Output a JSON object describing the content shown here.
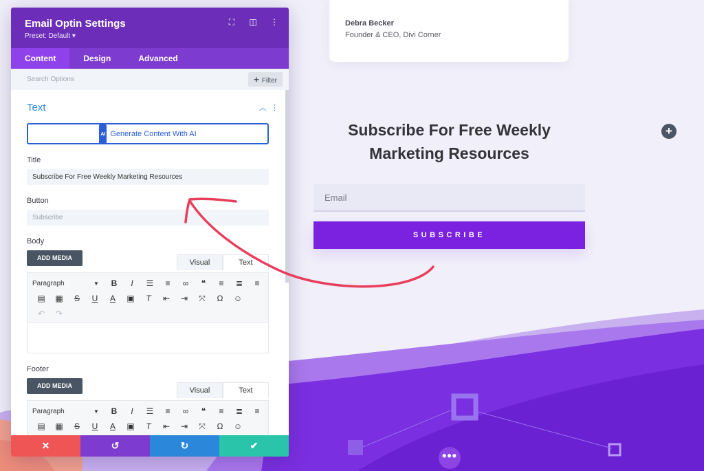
{
  "panel": {
    "title": "Email Optin Settings",
    "preset": "Preset: Default ▾",
    "header_icons": [
      "expand-icon",
      "split-view-icon",
      "more-vertical-icon"
    ],
    "tabs": [
      "Content",
      "Design",
      "Advanced"
    ],
    "active_tab": "Content",
    "search_placeholder": "Search Options",
    "filter_label": "Filter",
    "section_title": "Text",
    "ai_badge": "AI",
    "ai_button": "Generate Content With AI",
    "fields": {
      "title_label": "Title",
      "title_value": "Subscribe For Free Weekly Marketing Resources",
      "button_label": "Button",
      "button_placeholder": "Subscribe",
      "body_label": "Body",
      "footer_label": "Footer"
    },
    "editor": {
      "add_media": "ADD MEDIA",
      "tab_visual": "Visual",
      "tab_text": "Text",
      "paragraph": "Paragraph"
    }
  },
  "preview": {
    "testimonial_name": "Debra Becker",
    "testimonial_role": "Founder & CEO, Divi Corner",
    "optin_title": "Subscribe For Free Weekly Marketing Resources",
    "email_placeholder": "Email",
    "subscribe_label": "SUBSCRIBE"
  },
  "colors": {
    "panel_header": "#6c2eb9",
    "accent_blue": "#2b87da",
    "subscribe_button": "#7b22e0",
    "annotation_arrow": "#e83e5c"
  }
}
